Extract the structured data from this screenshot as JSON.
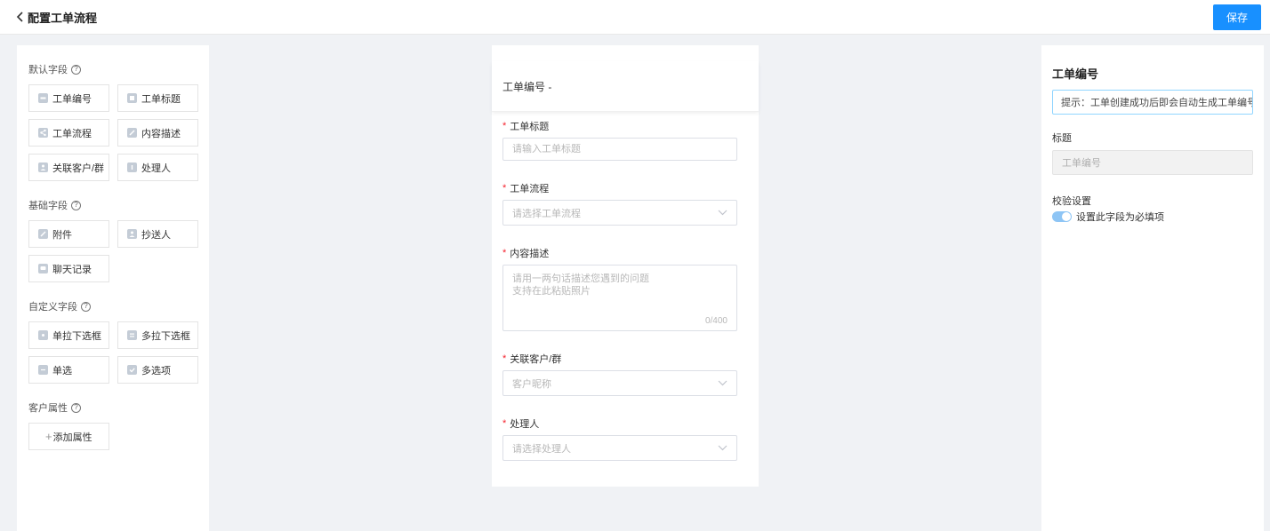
{
  "header": {
    "title": "配置工单流程",
    "save_label": "保存"
  },
  "sidebar": {
    "sections": [
      {
        "title": "默认字段",
        "help": "?",
        "items": [
          {
            "label": "工单编号",
            "icon": "id-icon"
          },
          {
            "label": "工单标题",
            "icon": "title-icon"
          },
          {
            "label": "工单流程",
            "icon": "share-icon"
          },
          {
            "label": "内容描述",
            "icon": "edit-icon"
          },
          {
            "label": "关联客户/群",
            "icon": "user-icon"
          },
          {
            "label": "处理人",
            "icon": "info-icon"
          }
        ]
      },
      {
        "title": "基础字段",
        "help": "?",
        "items": [
          {
            "label": "附件",
            "icon": "attachment-icon"
          },
          {
            "label": "抄送人",
            "icon": "user-icon"
          },
          {
            "label": "聊天记录",
            "icon": "chat-icon"
          }
        ]
      },
      {
        "title": "自定义字段",
        "help": "?",
        "items": [
          {
            "label": "单拉下选框",
            "icon": "dot-icon"
          },
          {
            "label": "多拉下选框",
            "icon": "list-icon"
          },
          {
            "label": "单选",
            "icon": "radio-icon"
          },
          {
            "label": "多选项",
            "icon": "checkbox-icon"
          }
        ]
      },
      {
        "title": "客户属性",
        "help": "?",
        "add_label": "添加属性",
        "add_plus": "+"
      }
    ]
  },
  "form": {
    "header": "工单编号  -",
    "fields": [
      {
        "label": "工单标题",
        "required": "*",
        "placeholder": "请输入工单标题"
      },
      {
        "label": "工单流程",
        "required": "*",
        "placeholder": "请选择工单流程"
      },
      {
        "label": "内容描述",
        "required": "*",
        "placeholder": "请用一两句话描述您遇到的问题\n支持在此粘贴照片",
        "counter": "0/400"
      },
      {
        "label": "关联客户/群",
        "required": "*",
        "placeholder": "客户昵称"
      },
      {
        "label": "处理人",
        "required": "*",
        "placeholder": "请选择处理人"
      }
    ]
  },
  "properties": {
    "title": "工单编号",
    "hint": "提示：工单创建成功后即会自动生成工单编号",
    "label_title": "标题",
    "title_value": "工单编号",
    "validation_label": "校验设置",
    "required_toggle_label": "设置此字段为必填项",
    "required_toggle_on": true
  },
  "colors": {
    "primary": "#1890ff",
    "required": "#f5222d",
    "background": "#f0f2f5"
  }
}
